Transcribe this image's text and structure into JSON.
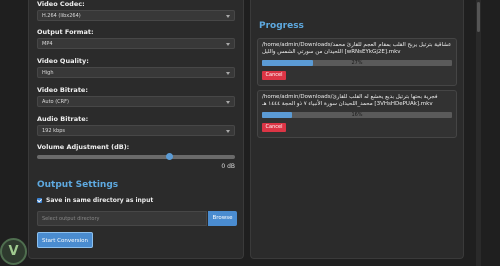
{
  "settings": {
    "video_codec_label": "Video Codec:",
    "video_codec_value": "H.264 (libx264)",
    "output_format_label": "Output Format:",
    "output_format_value": "MP4",
    "video_quality_label": "Video Quality:",
    "video_quality_value": "High",
    "video_bitrate_label": "Video Bitrate:",
    "video_bitrate_value": "Auto (CRF)",
    "audio_bitrate_label": "Audio Bitrate:",
    "audio_bitrate_value": "192 kbps",
    "volume_label": "Volume Adjustment (dB):",
    "volume_value": "0 dB",
    "volume_level_fraction": 0.67
  },
  "output": {
    "section_title": "Output Settings",
    "same_dir_label": "Save in same directory as input",
    "same_dir_checked": true,
    "dir_placeholder": "Select output directory",
    "browse_label": "Browse",
    "start_label": "Start Conversion"
  },
  "progress": {
    "section_title": "Progress",
    "cancel_label": "Cancel",
    "items": [
      {
        "line1": "/home/admin/Downloads/عشاقية بترتيل يربح القلب بمقام العجم للقارئ محمد",
        "line2": "اللحيدان من سورتي الشمس والليل [wRNsEYkGj2E].mkv",
        "percent_label": "27%",
        "percent": 27
      },
      {
        "line1": "/home/admin/Downloads/فجرية بحتها بترتيل بديع يخشع له القلب للقارئ",
        "line2": "محمد_اللحيدان سورة الأنبياء ٧ ذو الحجة ١٤٤٤ هـ [3VHsHDePUAk].mkv",
        "percent_label": "16%",
        "percent": 16
      }
    ]
  },
  "colors": {
    "accent": "#5ea9e0",
    "button": "#4a8cd0",
    "cancel": "#dc3545"
  }
}
